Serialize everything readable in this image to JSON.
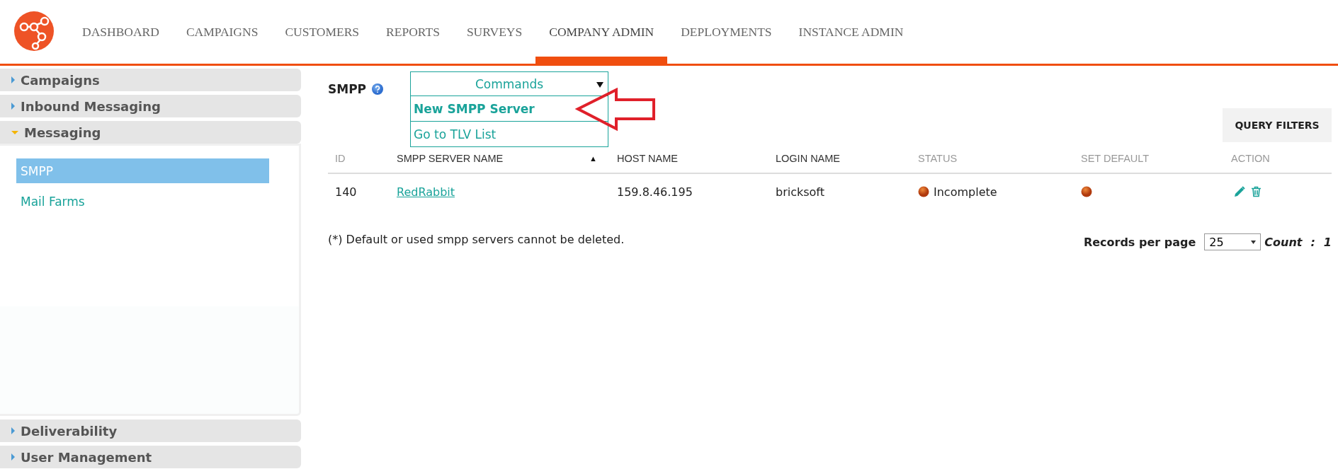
{
  "nav": {
    "items": [
      {
        "label": "DASHBOARD",
        "selected": false
      },
      {
        "label": "CAMPAIGNS",
        "selected": false
      },
      {
        "label": "CUSTOMERS",
        "selected": false
      },
      {
        "label": "REPORTS",
        "selected": false
      },
      {
        "label": "SURVEYS",
        "selected": false
      },
      {
        "label": "COMPANY ADMIN",
        "selected": true
      },
      {
        "label": "DEPLOYMENTS",
        "selected": false
      },
      {
        "label": "INSTANCE ADMIN",
        "selected": false
      }
    ]
  },
  "sidebar": {
    "sections": [
      {
        "label": "Campaigns",
        "expanded": false
      },
      {
        "label": "Inbound Messaging",
        "expanded": false
      },
      {
        "label": "Messaging",
        "expanded": true,
        "items": [
          {
            "label": "SMPP",
            "selected": true
          },
          {
            "label": "Mail Farms",
            "selected": false
          }
        ]
      },
      {
        "label": "Deliverability",
        "expanded": false
      },
      {
        "label": "User Management",
        "expanded": false
      }
    ]
  },
  "page": {
    "title": "SMPP"
  },
  "commands": {
    "label": "Commands",
    "expanded": true,
    "options": [
      {
        "label": "New SMPP Server",
        "highlighted": true
      },
      {
        "label": "Go to TLV List",
        "highlighted": false
      }
    ]
  },
  "query_filters": {
    "label": "QUERY FILTERS"
  },
  "table": {
    "columns": [
      {
        "label": "ID",
        "sortable": false
      },
      {
        "label": "SMPP SERVER NAME",
        "sortable": true,
        "sort_indicator": "▲"
      },
      {
        "label": "HOST NAME",
        "sortable": true
      },
      {
        "label": "LOGIN NAME",
        "sortable": true
      },
      {
        "label": "STATUS",
        "sortable": false
      },
      {
        "label": "SET DEFAULT",
        "sortable": false
      },
      {
        "label": "ACTION",
        "sortable": false
      }
    ],
    "rows": [
      {
        "id": "140",
        "name": "RedRabbit",
        "host": "159.8.46.195",
        "login": "bricksoft",
        "status": "Incomplete"
      }
    ]
  },
  "note": "(*) Default or used smpp servers cannot be deleted.",
  "pagination": {
    "label": "Records per page",
    "value": "25",
    "count_label": "Count",
    "count_separator": ":",
    "count": "1"
  }
}
